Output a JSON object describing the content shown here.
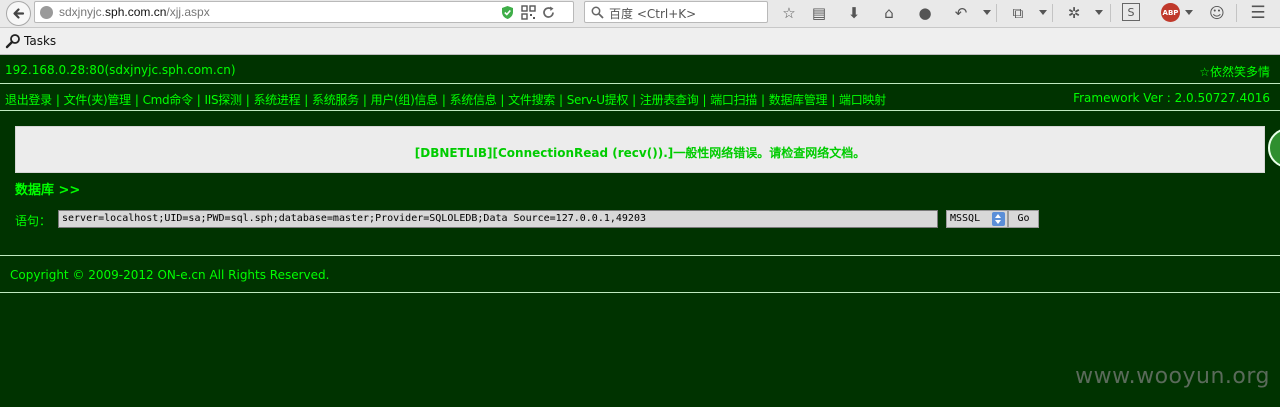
{
  "browser": {
    "url_prefix": "sdxjnyjc.",
    "url_domain": "sph.com.cn",
    "url_path": "/xjj.aspx",
    "search_engine": "百度",
    "search_shortcut": "<Ctrl+K>",
    "abp_label": "ABP"
  },
  "tasks_bar": {
    "label": "Tasks"
  },
  "page": {
    "host_text": "192.168.0.28:80(sdxjnyjc.sph.com.cn)",
    "user_text": "☆依然笑多情",
    "nav_items": [
      "退出登录",
      "文件(夹)管理",
      "Cmd命令",
      "IIS探测",
      "系统进程",
      "系统服务",
      "用户(组)信息",
      "系统信息",
      "文件搜索",
      "Serv-U提权",
      "注册表查询",
      "端口扫描",
      "数据库管理",
      "端口映射"
    ],
    "version_text": "Framework Ver : 2.0.50727.4016",
    "error_message": "[DBNETLIB][ConnectionRead (recv()).]一般性网络错误。请检查网络文档。",
    "section_title": "数据库 >>",
    "statement_label": "语句：",
    "connection_string": "server=localhost;UID=sa;PWD=sql.sph;database=master;Provider=SQLOLEDB;Data Source=127.0.0.1,49203",
    "db_type": "MSSQL",
    "go_label": "Go",
    "copyright": "Copyright © 2009-2012 ON-e.cn All Rights Reserved."
  },
  "watermark": "www.wooyun.org",
  "colors": {
    "page_background": "#003300",
    "text_green": "#00ff00",
    "message_green": "#00cc00",
    "message_box": "#ececec"
  }
}
